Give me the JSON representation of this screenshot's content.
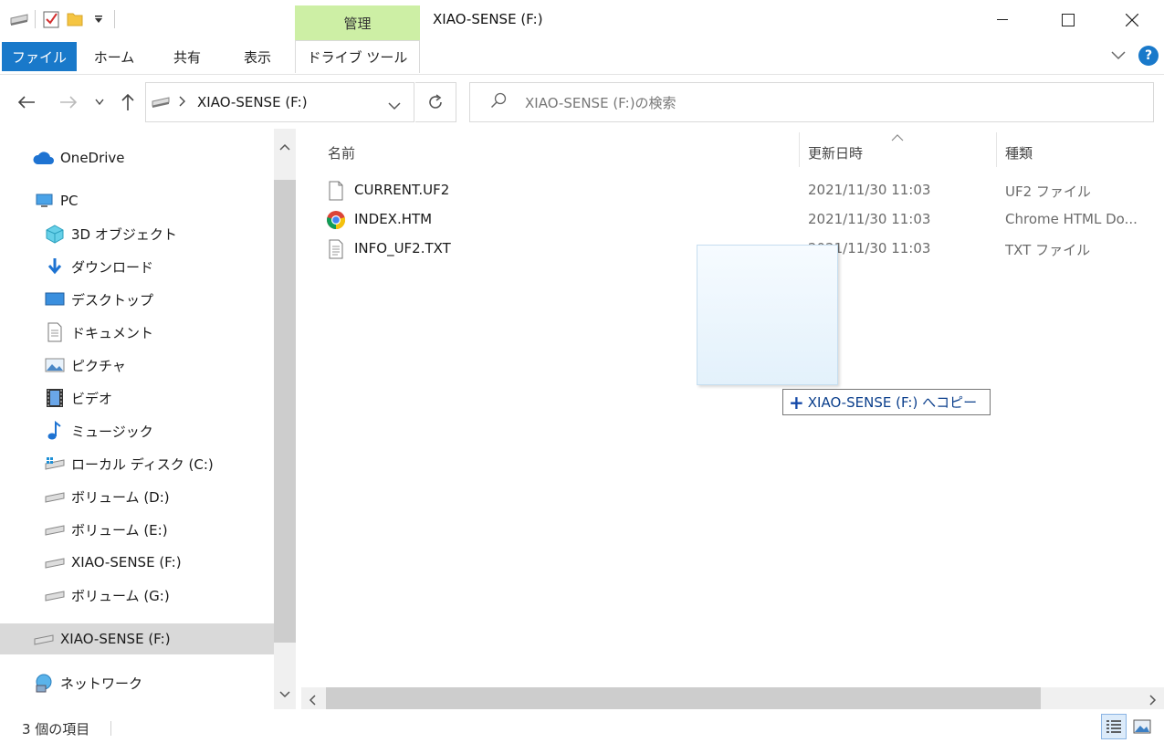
{
  "window": {
    "title": "XIAO-SENSE (F:)",
    "context_tab": "管理"
  },
  "ribbon": {
    "tabs": [
      "ファイル",
      "ホーム",
      "共有",
      "表示",
      "ドライブ ツール"
    ],
    "help": "?"
  },
  "address": {
    "path": "XIAO-SENSE (F:)",
    "search_placeholder": "XIAO-SENSE (F:)の検索"
  },
  "nav": {
    "items": [
      {
        "label": "OneDrive",
        "icon": "onedrive-icon"
      },
      {
        "label": "PC",
        "icon": "pc-icon"
      },
      {
        "label": "3D オブジェクト",
        "icon": "3d-objects-icon"
      },
      {
        "label": "ダウンロード",
        "icon": "download-icon"
      },
      {
        "label": "デスクトップ",
        "icon": "desktop-icon"
      },
      {
        "label": "ドキュメント",
        "icon": "document-icon"
      },
      {
        "label": "ピクチャ",
        "icon": "pictures-icon"
      },
      {
        "label": "ビデオ",
        "icon": "video-icon"
      },
      {
        "label": "ミュージック",
        "icon": "music-icon"
      },
      {
        "label": "ローカル ディスク (C:)",
        "icon": "local-disk-icon"
      },
      {
        "label": "ボリューム (D:)",
        "icon": "drive-icon"
      },
      {
        "label": "ボリューム (E:)",
        "icon": "drive-icon"
      },
      {
        "label": "XIAO-SENSE (F:)",
        "icon": "drive-icon"
      },
      {
        "label": "ボリューム (G:)",
        "icon": "drive-icon"
      },
      {
        "label": "XIAO-SENSE (F:)",
        "icon": "drive-icon"
      },
      {
        "label": "ネットワーク",
        "icon": "network-icon"
      }
    ]
  },
  "columns": {
    "name": "名前",
    "date": "更新日時",
    "type": "種類"
  },
  "files": [
    {
      "name": "CURRENT.UF2",
      "date": "2021/11/30 11:03",
      "type": "UF2 ファイル",
      "icon": "file-icon"
    },
    {
      "name": "INDEX.HTM",
      "date": "2021/11/30 11:03",
      "type": "Chrome HTML Do...",
      "icon": "chrome-icon"
    },
    {
      "name": "INFO_UF2.TXT",
      "date": "2021/11/30 11:03",
      "type": "TXT ファイル",
      "icon": "text-file-icon"
    }
  ],
  "drag": {
    "tooltip": "XIAO-SENSE (F:) へコピー"
  },
  "status": {
    "count": "3 個の項目"
  },
  "colors": {
    "file_tab": "#1979ca",
    "manage_tab": "#cdefa5",
    "selection": "#d9d9d9"
  }
}
